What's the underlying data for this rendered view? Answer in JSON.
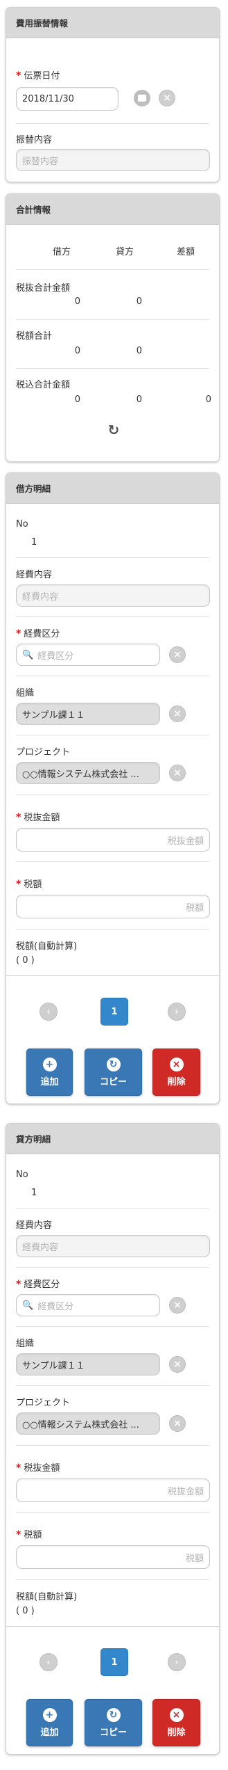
{
  "panel1": {
    "title": "費用振替情報",
    "date_label": "伝票日付",
    "date_value": "2018/11/30",
    "content_label": "振替内容",
    "content_placeholder": "振替内容"
  },
  "panel2": {
    "title": "合計情報",
    "col_debit": "借方",
    "col_credit": "貸方",
    "col_diff": "差額",
    "rows": [
      {
        "label": "税抜合計金額",
        "debit": "0",
        "credit": "0",
        "diff": ""
      },
      {
        "label": "税額合計",
        "debit": "0",
        "credit": "0",
        "diff": ""
      },
      {
        "label": "税込合計金額",
        "debit": "0",
        "credit": "0",
        "diff": "0"
      }
    ]
  },
  "debit": {
    "title": "借方明細",
    "no_label": "No",
    "no_value": "1",
    "content_label": "経費内容",
    "content_placeholder": "経費内容",
    "category_label": "経費区分",
    "category_placeholder": "経費区分",
    "org_label": "組織",
    "org_value": "サンプル課１１",
    "project_label": "プロジェクト",
    "project_value": "○○情報システム株式会社 ...",
    "amount_label": "税抜金額",
    "amount_placeholder": "税抜金額",
    "tax_label": "税額",
    "tax_placeholder": "税額",
    "auto_tax_label": "税額(自動計算)",
    "auto_tax_value": "( 0 )",
    "page": "1",
    "add_label": "追加",
    "copy_label": "コピー",
    "delete_label": "削除"
  },
  "credit": {
    "title": "貸方明細",
    "no_label": "No",
    "no_value": "1",
    "content_label": "経費内容",
    "content_placeholder": "経費内容",
    "category_label": "経費区分",
    "category_placeholder": "経費区分",
    "org_label": "組織",
    "org_value": "サンプル課１１",
    "project_label": "プロジェクト",
    "project_value": "○○情報システム株式会社 ...",
    "amount_label": "税抜金額",
    "amount_placeholder": "税抜金額",
    "tax_label": "税額",
    "tax_placeholder": "税額",
    "auto_tax_label": "税額(自動計算)",
    "auto_tax_value": "( 0 )",
    "page": "1",
    "add_label": "追加",
    "copy_label": "コピー",
    "delete_label": "削除"
  },
  "colors": {
    "panel_header": "#d9d9d9",
    "required": "#d9181d",
    "primary_button": "#3a78b5",
    "delete_button": "#d02a27",
    "page_active": "#3388cc"
  }
}
